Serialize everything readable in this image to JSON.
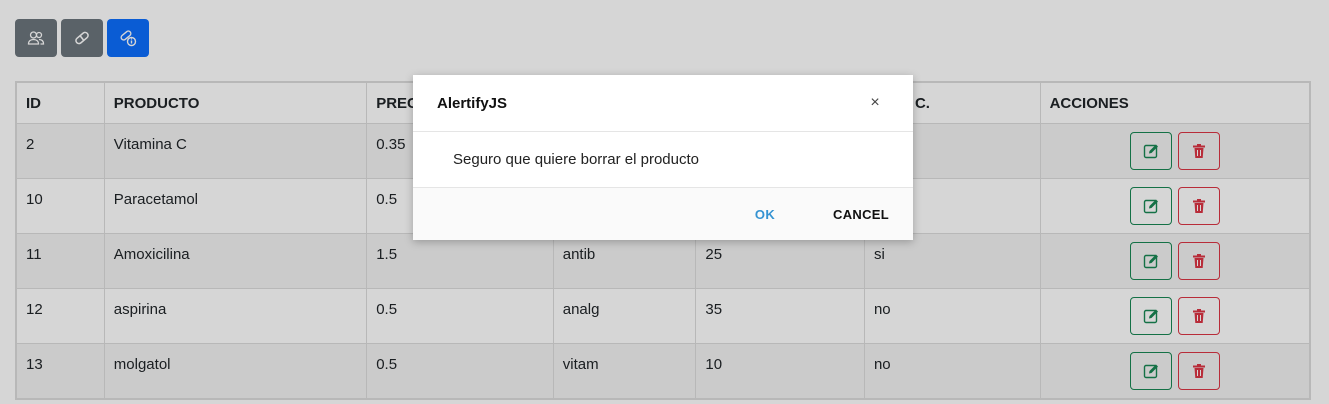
{
  "toolbar": {
    "buttons": [
      {
        "icon": "users-icon",
        "active": false
      },
      {
        "icon": "capsule-icon",
        "active": false
      },
      {
        "icon": "pills-info-icon",
        "active": true
      }
    ]
  },
  "table": {
    "headers": [
      "ID",
      "PRODUCTO",
      "PREC",
      "",
      "",
      "C.",
      "ACCIONES"
    ],
    "rows": [
      {
        "id": "2",
        "producto": "Vitamina C",
        "precio": "0.35",
        "categoria": "",
        "stock": "",
        "receta": ""
      },
      {
        "id": "10",
        "producto": "Paracetamol",
        "precio": "0.5",
        "categoria": "",
        "stock": "",
        "receta": ""
      },
      {
        "id": "11",
        "producto": "Amoxicilina",
        "precio": "1.5",
        "categoria": "antib",
        "stock": "25",
        "receta": "si"
      },
      {
        "id": "12",
        "producto": "aspirina",
        "precio": "0.5",
        "categoria": "analg",
        "stock": "35",
        "receta": "no"
      },
      {
        "id": "13",
        "producto": "molgatol",
        "precio": "0.5",
        "categoria": "vitam",
        "stock": "10",
        "receta": "no"
      }
    ]
  },
  "dialog": {
    "title": "AlertifyJS",
    "close": "×",
    "message": "Seguro que quiere borrar el producto",
    "ok": "OK",
    "cancel": "CANCEL"
  },
  "colors": {
    "primary": "#0d6efd",
    "secondary": "#6c757d",
    "success": "#198754",
    "danger": "#dc3545",
    "ok_link": "#3593d2"
  }
}
